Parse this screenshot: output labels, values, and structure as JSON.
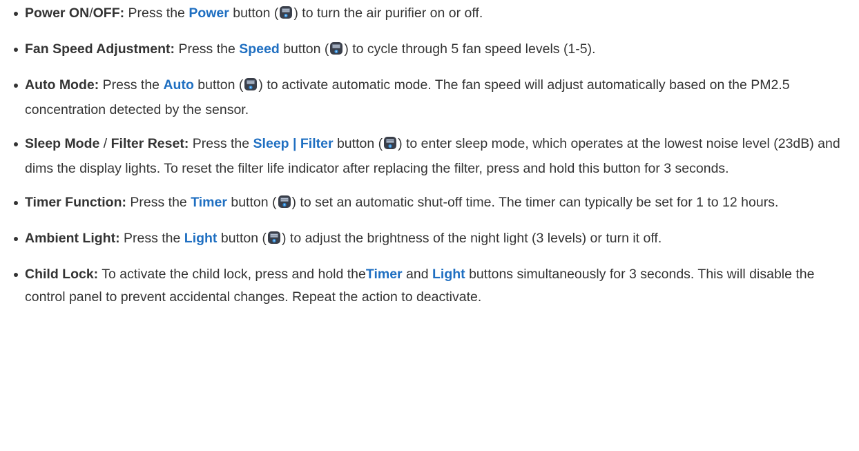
{
  "items": [
    {
      "segments": [
        {
          "text": "Power ON",
          "kind": "term"
        },
        {
          "text": "/",
          "kind": "text"
        },
        {
          "text": "OFF:",
          "kind": "term"
        },
        {
          "text": " Press the ",
          "kind": "text"
        },
        {
          "text": "Power",
          "kind": "button"
        },
        {
          "text": " button (",
          "kind": "text"
        },
        {
          "kind": "icon",
          "icon": "button-icon"
        },
        {
          "text": ") to turn the air purifier on or off.",
          "kind": "text"
        }
      ]
    },
    {
      "segments": [
        {
          "text": "Fan Speed Adjustment:",
          "kind": "term"
        },
        {
          "text": " Press the ",
          "kind": "text"
        },
        {
          "text": "Speed",
          "kind": "button"
        },
        {
          "text": " button (",
          "kind": "text"
        },
        {
          "kind": "icon",
          "icon": "button-icon"
        },
        {
          "text": ") to cycle through 5 fan speed levels (1-5).",
          "kind": "text"
        }
      ]
    },
    {
      "segments": [
        {
          "text": "Auto Mode:",
          "kind": "term"
        },
        {
          "text": " Press the ",
          "kind": "text"
        },
        {
          "text": "Auto",
          "kind": "button"
        },
        {
          "text": " button (",
          "kind": "text"
        },
        {
          "kind": "icon",
          "icon": "button-icon"
        },
        {
          "text": ") to activate automatic mode. The fan speed will adjust automatically based on the PM2.5 concentration detected by the sensor.",
          "kind": "text"
        }
      ]
    },
    {
      "segments": [
        {
          "text": "Sleep Mode",
          "kind": "term"
        },
        {
          "text": " / ",
          "kind": "text"
        },
        {
          "text": "Filter Reset:",
          "kind": "term"
        },
        {
          "text": " Press the ",
          "kind": "text"
        },
        {
          "text": "Sleep | Filter",
          "kind": "button"
        },
        {
          "text": " button (",
          "kind": "text"
        },
        {
          "kind": "icon",
          "icon": "button-icon"
        },
        {
          "text": ") to enter sleep mode, which operates at the lowest noise level (23dB) and dims the display lights. To reset the filter life indicator after replacing the filter, press and hold this button for 3 seconds.",
          "kind": "text"
        }
      ]
    },
    {
      "segments": [
        {
          "text": "Timer Function:",
          "kind": "term"
        },
        {
          "text": " Press the ",
          "kind": "text"
        },
        {
          "text": "Timer",
          "kind": "button"
        },
        {
          "text": " button (",
          "kind": "text"
        },
        {
          "kind": "icon",
          "icon": "button-icon"
        },
        {
          "text": ") to set an automatic shut-off time. The timer can typically be set for 1 to 12 hours.",
          "kind": "text"
        }
      ]
    },
    {
      "segments": [
        {
          "text": "Ambient Light:",
          "kind": "term"
        },
        {
          "text": " Press the ",
          "kind": "text"
        },
        {
          "text": "Light",
          "kind": "button"
        },
        {
          "text": " button (",
          "kind": "text"
        },
        {
          "kind": "icon",
          "icon": "button-icon"
        },
        {
          "text": ") to adjust the brightness of the night light (3 levels) or turn it off.",
          "kind": "text"
        }
      ]
    },
    {
      "segments": [
        {
          "text": "Child Lock:",
          "kind": "term"
        },
        {
          "text": " To activate the child lock, press and hold the",
          "kind": "text"
        },
        {
          "text": "Timer",
          "kind": "button"
        },
        {
          "text": " and ",
          "kind": "text"
        },
        {
          "text": "Light",
          "kind": "button"
        },
        {
          "text": " buttons simultaneously for 3 seconds. This will disable the control panel to prevent accidental changes. Repeat the action to deactivate.",
          "kind": "text"
        }
      ]
    }
  ],
  "colors": {
    "text": "#333333",
    "button_name": "#1f6fc1"
  }
}
